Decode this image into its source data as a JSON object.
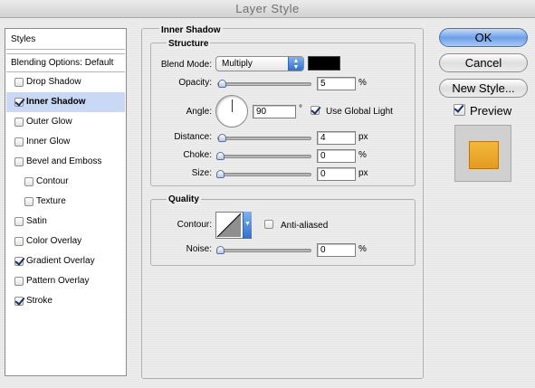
{
  "window": {
    "title": "Layer Style"
  },
  "styles_panel": {
    "header": "Styles",
    "blending": "Blending Options: Default",
    "items": [
      {
        "label": "Drop Shadow",
        "checked": false,
        "selected": false,
        "indent": false
      },
      {
        "label": "Inner Shadow",
        "checked": true,
        "selected": true,
        "indent": false
      },
      {
        "label": "Outer Glow",
        "checked": false,
        "selected": false,
        "indent": false
      },
      {
        "label": "Inner Glow",
        "checked": false,
        "selected": false,
        "indent": false
      },
      {
        "label": "Bevel and Emboss",
        "checked": false,
        "selected": false,
        "indent": false
      },
      {
        "label": "Contour",
        "checked": false,
        "selected": false,
        "indent": true
      },
      {
        "label": "Texture",
        "checked": false,
        "selected": false,
        "indent": true
      },
      {
        "label": "Satin",
        "checked": false,
        "selected": false,
        "indent": false
      },
      {
        "label": "Color Overlay",
        "checked": false,
        "selected": false,
        "indent": false
      },
      {
        "label": "Gradient Overlay",
        "checked": true,
        "selected": false,
        "indent": false
      },
      {
        "label": "Pattern Overlay",
        "checked": false,
        "selected": false,
        "indent": false
      },
      {
        "label": "Stroke",
        "checked": true,
        "selected": false,
        "indent": false
      }
    ]
  },
  "inner_shadow": {
    "title": "Inner Shadow",
    "structure": {
      "title": "Structure",
      "blend_mode_label": "Blend Mode:",
      "blend_mode_value": "Multiply",
      "shadow_color": "#000000",
      "opacity_label": "Opacity:",
      "opacity_value": "5",
      "opacity_unit": "%",
      "angle_label": "Angle:",
      "angle_value": "90",
      "angle_unit": "°",
      "use_global_light": "Use Global Light",
      "use_global_light_checked": true,
      "distance_label": "Distance:",
      "distance_value": "4",
      "distance_unit": "px",
      "choke_label": "Choke:",
      "choke_value": "0",
      "choke_unit": "%",
      "size_label": "Size:",
      "size_value": "0",
      "size_unit": "px"
    },
    "quality": {
      "title": "Quality",
      "contour_label": "Contour:",
      "anti_aliased": "Anti-aliased",
      "anti_aliased_checked": false,
      "noise_label": "Noise:",
      "noise_value": "0",
      "noise_unit": "%"
    }
  },
  "buttons": {
    "ok": "OK",
    "cancel": "Cancel",
    "new_style": "New Style...",
    "preview": "Preview",
    "preview_checked": true
  },
  "colors": {
    "preview_swatch": "#e9a62c",
    "selection_highlight": "#c9d9f5"
  }
}
